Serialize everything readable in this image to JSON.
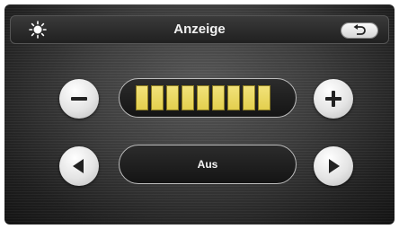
{
  "header": {
    "title": "Anzeige",
    "left_icon": "sun-icon",
    "back_icon": "back-arrow-icon"
  },
  "brightness": {
    "decrease_icon": "minus-icon",
    "increase_icon": "plus-icon",
    "segments": 9,
    "filled_segments": 9,
    "segment_color": "#e8d55a"
  },
  "mode": {
    "value": "Aus",
    "prev_icon": "triangle-left-icon",
    "next_icon": "triangle-right-icon"
  }
}
